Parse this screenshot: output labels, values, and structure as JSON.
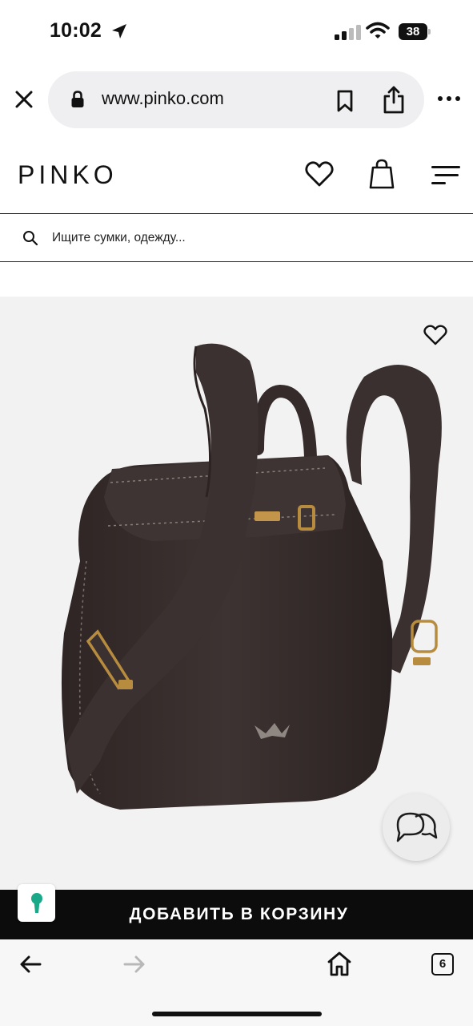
{
  "status_bar": {
    "time": "10:02",
    "battery": "38",
    "icons": [
      "location-arrow-icon",
      "signal-bars-icon",
      "wifi-icon",
      "battery-icon"
    ]
  },
  "browser": {
    "url": "www.pinko.com",
    "icons": [
      "close-icon",
      "lock-icon",
      "bookmark-icon",
      "share-icon",
      "more-icon"
    ]
  },
  "header": {
    "logo": "PINKO",
    "icons": [
      "heart-icon",
      "shopping-bag-icon",
      "menu-icon"
    ]
  },
  "search": {
    "placeholder": "Ищите сумки, одежду..."
  },
  "product": {
    "image": "dark-brown-leather-backpack",
    "icons": [
      "wishlist-heart-icon",
      "chat-icon"
    ],
    "colors": {
      "leather": "#3a302f",
      "background": "#f2f2f2",
      "hardware": "#b88c3e"
    }
  },
  "cart": {
    "label": "ДОБАВИТЬ В КОРЗИНУ",
    "background": "#0c0c0c"
  },
  "toolbar": {
    "tabs_count": "6",
    "icons": [
      "back-arrow-icon",
      "forward-arrow-icon",
      "home-icon",
      "tabs-icon"
    ]
  }
}
